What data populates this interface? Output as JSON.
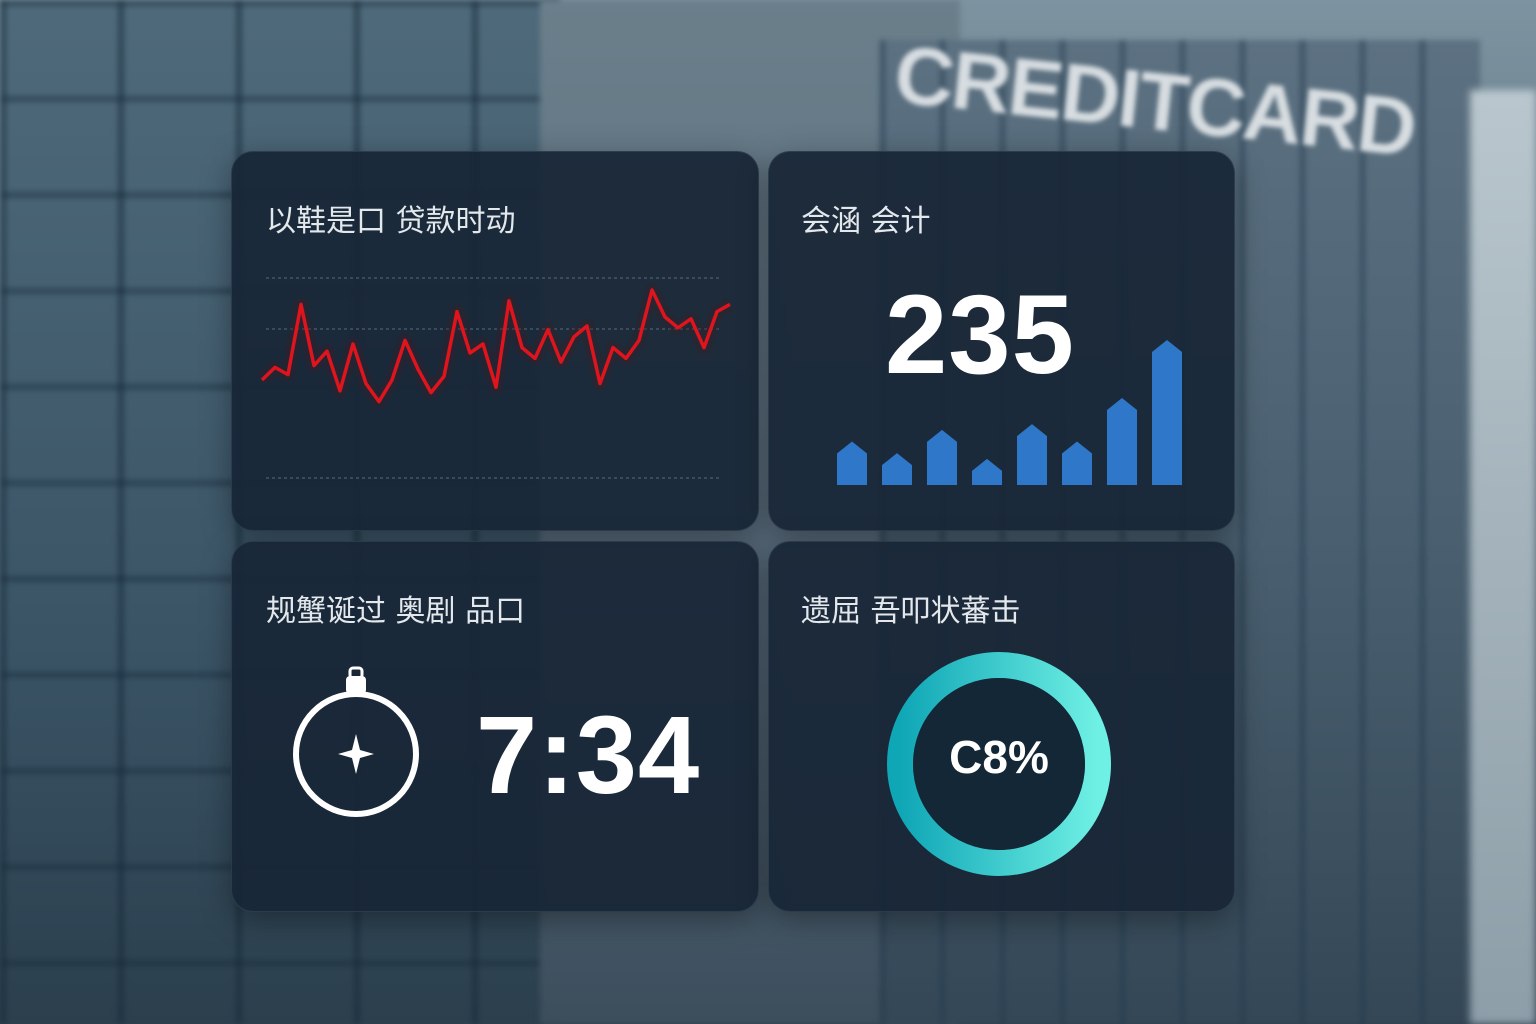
{
  "background": {
    "sign_text": "CREDITCARD"
  },
  "cards": {
    "line_card": {
      "title": "以鞋是口 贷款时动",
      "line_color": "#e0141c",
      "values": [
        40,
        47,
        43,
        82,
        48,
        56,
        34,
        60,
        38,
        28,
        40,
        62,
        46,
        33,
        42,
        78,
        55,
        60,
        36,
        84,
        58,
        52,
        68,
        50,
        64,
        70,
        38,
        58,
        52,
        62,
        90,
        75,
        69,
        74,
        58,
        78,
        82
      ]
    },
    "bar_card": {
      "title": "会涵 会计",
      "value": "235",
      "bar_color": "#2f77c9",
      "bars": [
        30,
        22,
        38,
        18,
        42,
        30,
        60,
        100
      ]
    },
    "time_card": {
      "title": "规蟹诞过 奥剧 品口",
      "value": "7:34",
      "icon": "stopwatch-icon"
    },
    "ring_card": {
      "title": "遗屈 吾叩状蕃击",
      "label": "C8%",
      "ring_color_start": "#0fa6b6",
      "ring_color_end": "#6ff0e4",
      "track_color": "#17404e"
    }
  }
}
